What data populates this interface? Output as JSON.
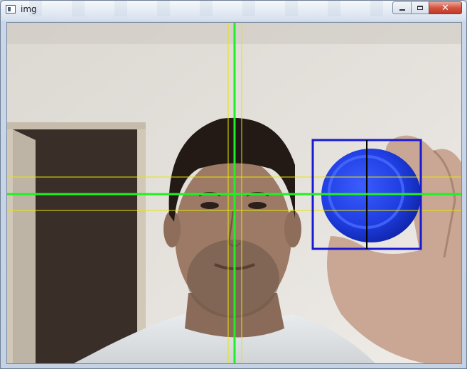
{
  "window": {
    "title": "img",
    "controls": {
      "minimize_icon": "minimize-icon",
      "maximize_icon": "maximize-icon",
      "close_icon": "close-icon",
      "close_glyph": "✕"
    }
  },
  "overlay": {
    "colors": {
      "green": "#22ee22",
      "yellow": "#e6e600",
      "blue_box": "#1a1ad0",
      "black_line": "#000000"
    }
  }
}
